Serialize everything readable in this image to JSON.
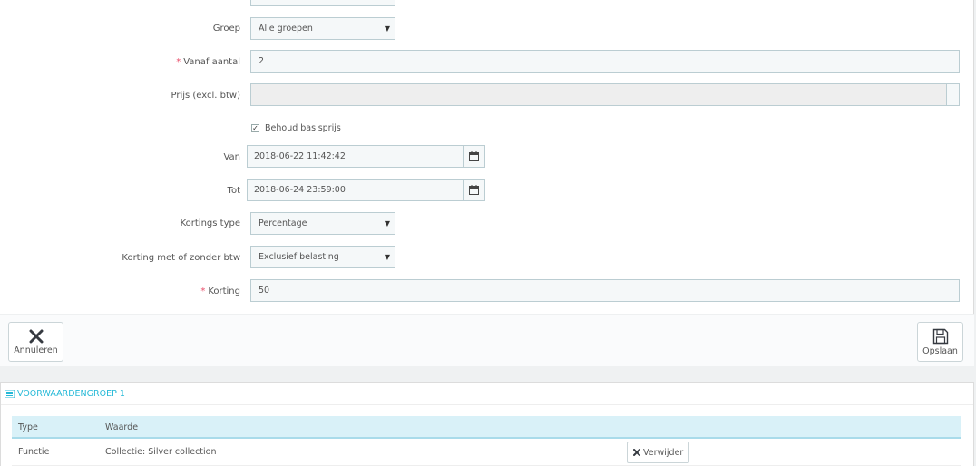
{
  "form": {
    "group": {
      "label": "Groep",
      "value": "Alle groepen"
    },
    "from_quantity": {
      "label": "Vanaf aantal",
      "required_mark": "*",
      "value": "2"
    },
    "price": {
      "label": "Prijs (excl. btw)",
      "value": ""
    },
    "keep_base_price": {
      "label": "Behoud basisprijs",
      "checked": true,
      "check_glyph": "✓"
    },
    "from_date": {
      "label": "Van",
      "value": "2018-06-22 11:42:42"
    },
    "to_date": {
      "label": "Tot",
      "value": "2018-06-24 23:59:00"
    },
    "discount_type": {
      "label": "Kortings type",
      "value": "Percentage"
    },
    "discount_tax": {
      "label": "Korting met of zonder btw",
      "value": "Exclusief belasting"
    },
    "discount": {
      "label": "Korting",
      "required_mark": "*",
      "value": "50"
    }
  },
  "footer": {
    "cancel_label": "Annuleren",
    "save_label": "Opslaan"
  },
  "conditions": {
    "heading": "VOORWAARDENGROEP 1",
    "columns": [
      "Type",
      "Waarde"
    ],
    "rows": [
      {
        "type": "Functie",
        "value": "Collectie: Silver collection",
        "action_label": "Verwijder"
      }
    ]
  },
  "icons": {
    "caret": "caret-down-icon",
    "calendar": "calendar-icon",
    "cancel": "close-icon",
    "save": "floppy-disk-icon",
    "delete": "close-icon",
    "conditions": "list-icon"
  },
  "colors": {
    "accent": "#25b9d7",
    "required": "#e84e6a",
    "table_header": "#d9f1f8"
  }
}
